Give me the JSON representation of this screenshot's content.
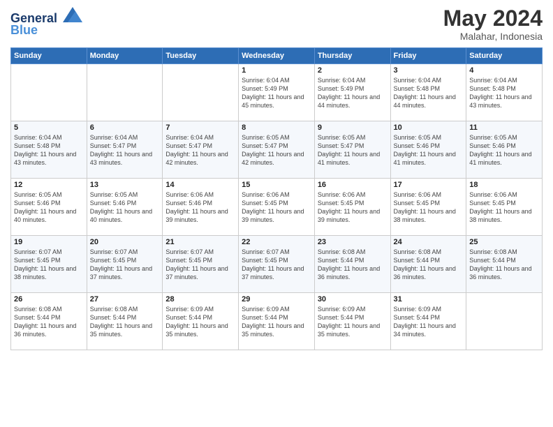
{
  "header": {
    "logo_line1": "General",
    "logo_line2": "Blue",
    "month": "May 2024",
    "location": "Malahar, Indonesia"
  },
  "weekdays": [
    "Sunday",
    "Monday",
    "Tuesday",
    "Wednesday",
    "Thursday",
    "Friday",
    "Saturday"
  ],
  "weeks": [
    [
      {
        "day": "",
        "sunrise": "",
        "sunset": "",
        "daylight": ""
      },
      {
        "day": "",
        "sunrise": "",
        "sunset": "",
        "daylight": ""
      },
      {
        "day": "",
        "sunrise": "",
        "sunset": "",
        "daylight": ""
      },
      {
        "day": "1",
        "sunrise": "Sunrise: 6:04 AM",
        "sunset": "Sunset: 5:49 PM",
        "daylight": "Daylight: 11 hours and 45 minutes."
      },
      {
        "day": "2",
        "sunrise": "Sunrise: 6:04 AM",
        "sunset": "Sunset: 5:49 PM",
        "daylight": "Daylight: 11 hours and 44 minutes."
      },
      {
        "day": "3",
        "sunrise": "Sunrise: 6:04 AM",
        "sunset": "Sunset: 5:48 PM",
        "daylight": "Daylight: 11 hours and 44 minutes."
      },
      {
        "day": "4",
        "sunrise": "Sunrise: 6:04 AM",
        "sunset": "Sunset: 5:48 PM",
        "daylight": "Daylight: 11 hours and 43 minutes."
      }
    ],
    [
      {
        "day": "5",
        "sunrise": "Sunrise: 6:04 AM",
        "sunset": "Sunset: 5:48 PM",
        "daylight": "Daylight: 11 hours and 43 minutes."
      },
      {
        "day": "6",
        "sunrise": "Sunrise: 6:04 AM",
        "sunset": "Sunset: 5:47 PM",
        "daylight": "Daylight: 11 hours and 43 minutes."
      },
      {
        "day": "7",
        "sunrise": "Sunrise: 6:04 AM",
        "sunset": "Sunset: 5:47 PM",
        "daylight": "Daylight: 11 hours and 42 minutes."
      },
      {
        "day": "8",
        "sunrise": "Sunrise: 6:05 AM",
        "sunset": "Sunset: 5:47 PM",
        "daylight": "Daylight: 11 hours and 42 minutes."
      },
      {
        "day": "9",
        "sunrise": "Sunrise: 6:05 AM",
        "sunset": "Sunset: 5:47 PM",
        "daylight": "Daylight: 11 hours and 41 minutes."
      },
      {
        "day": "10",
        "sunrise": "Sunrise: 6:05 AM",
        "sunset": "Sunset: 5:46 PM",
        "daylight": "Daylight: 11 hours and 41 minutes."
      },
      {
        "day": "11",
        "sunrise": "Sunrise: 6:05 AM",
        "sunset": "Sunset: 5:46 PM",
        "daylight": "Daylight: 11 hours and 41 minutes."
      }
    ],
    [
      {
        "day": "12",
        "sunrise": "Sunrise: 6:05 AM",
        "sunset": "Sunset: 5:46 PM",
        "daylight": "Daylight: 11 hours and 40 minutes."
      },
      {
        "day": "13",
        "sunrise": "Sunrise: 6:05 AM",
        "sunset": "Sunset: 5:46 PM",
        "daylight": "Daylight: 11 hours and 40 minutes."
      },
      {
        "day": "14",
        "sunrise": "Sunrise: 6:06 AM",
        "sunset": "Sunset: 5:46 PM",
        "daylight": "Daylight: 11 hours and 39 minutes."
      },
      {
        "day": "15",
        "sunrise": "Sunrise: 6:06 AM",
        "sunset": "Sunset: 5:45 PM",
        "daylight": "Daylight: 11 hours and 39 minutes."
      },
      {
        "day": "16",
        "sunrise": "Sunrise: 6:06 AM",
        "sunset": "Sunset: 5:45 PM",
        "daylight": "Daylight: 11 hours and 39 minutes."
      },
      {
        "day": "17",
        "sunrise": "Sunrise: 6:06 AM",
        "sunset": "Sunset: 5:45 PM",
        "daylight": "Daylight: 11 hours and 38 minutes."
      },
      {
        "day": "18",
        "sunrise": "Sunrise: 6:06 AM",
        "sunset": "Sunset: 5:45 PM",
        "daylight": "Daylight: 11 hours and 38 minutes."
      }
    ],
    [
      {
        "day": "19",
        "sunrise": "Sunrise: 6:07 AM",
        "sunset": "Sunset: 5:45 PM",
        "daylight": "Daylight: 11 hours and 38 minutes."
      },
      {
        "day": "20",
        "sunrise": "Sunrise: 6:07 AM",
        "sunset": "Sunset: 5:45 PM",
        "daylight": "Daylight: 11 hours and 37 minutes."
      },
      {
        "day": "21",
        "sunrise": "Sunrise: 6:07 AM",
        "sunset": "Sunset: 5:45 PM",
        "daylight": "Daylight: 11 hours and 37 minutes."
      },
      {
        "day": "22",
        "sunrise": "Sunrise: 6:07 AM",
        "sunset": "Sunset: 5:45 PM",
        "daylight": "Daylight: 11 hours and 37 minutes."
      },
      {
        "day": "23",
        "sunrise": "Sunrise: 6:08 AM",
        "sunset": "Sunset: 5:44 PM",
        "daylight": "Daylight: 11 hours and 36 minutes."
      },
      {
        "day": "24",
        "sunrise": "Sunrise: 6:08 AM",
        "sunset": "Sunset: 5:44 PM",
        "daylight": "Daylight: 11 hours and 36 minutes."
      },
      {
        "day": "25",
        "sunrise": "Sunrise: 6:08 AM",
        "sunset": "Sunset: 5:44 PM",
        "daylight": "Daylight: 11 hours and 36 minutes."
      }
    ],
    [
      {
        "day": "26",
        "sunrise": "Sunrise: 6:08 AM",
        "sunset": "Sunset: 5:44 PM",
        "daylight": "Daylight: 11 hours and 36 minutes."
      },
      {
        "day": "27",
        "sunrise": "Sunrise: 6:08 AM",
        "sunset": "Sunset: 5:44 PM",
        "daylight": "Daylight: 11 hours and 35 minutes."
      },
      {
        "day": "28",
        "sunrise": "Sunrise: 6:09 AM",
        "sunset": "Sunset: 5:44 PM",
        "daylight": "Daylight: 11 hours and 35 minutes."
      },
      {
        "day": "29",
        "sunrise": "Sunrise: 6:09 AM",
        "sunset": "Sunset: 5:44 PM",
        "daylight": "Daylight: 11 hours and 35 minutes."
      },
      {
        "day": "30",
        "sunrise": "Sunrise: 6:09 AM",
        "sunset": "Sunset: 5:44 PM",
        "daylight": "Daylight: 11 hours and 35 minutes."
      },
      {
        "day": "31",
        "sunrise": "Sunrise: 6:09 AM",
        "sunset": "Sunset: 5:44 PM",
        "daylight": "Daylight: 11 hours and 34 minutes."
      },
      {
        "day": "",
        "sunrise": "",
        "sunset": "",
        "daylight": ""
      }
    ]
  ]
}
